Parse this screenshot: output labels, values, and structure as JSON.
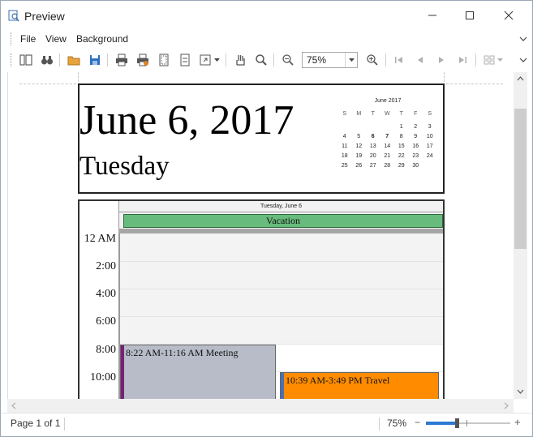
{
  "window": {
    "title": "Preview",
    "icon": "preview-app-icon"
  },
  "menu": {
    "items": [
      {
        "label": "File"
      },
      {
        "label": "View"
      },
      {
        "label": "Background"
      }
    ]
  },
  "toolbar": {
    "zoom_value": "75%",
    "icons": [
      "thumbnails-icon",
      "search-binoculars-icon",
      "open-folder-icon",
      "save-icon",
      "print-icon",
      "quick-print-icon",
      "page-setup-icon",
      "scale-icon",
      "page-margins-icon",
      "hand-tool-icon",
      "magnifier-icon",
      "zoom-out-icon",
      "zoom-in-icon",
      "first-page-icon",
      "previous-page-icon",
      "next-page-icon",
      "last-page-icon",
      "multiple-pages-icon"
    ]
  },
  "calendar_page": {
    "date_heading": "June 6, 2017",
    "weekday_heading": "Tuesday",
    "mini_calendar": {
      "title": "June 2017",
      "weekdays": [
        "S",
        "M",
        "T",
        "W",
        "T",
        "F",
        "S"
      ],
      "weeks": [
        [
          "",
          "",
          "",
          "",
          "1",
          "2",
          "3"
        ],
        [
          "4",
          "5",
          "6",
          "7",
          "8",
          "9",
          "10"
        ],
        [
          "11",
          "12",
          "13",
          "14",
          "15",
          "16",
          "17"
        ],
        [
          "18",
          "19",
          "20",
          "21",
          "22",
          "23",
          "24"
        ],
        [
          "25",
          "26",
          "27",
          "28",
          "29",
          "30",
          ""
        ]
      ],
      "bold_days": [
        "6",
        "7"
      ]
    },
    "day_view": {
      "column_header": "Tuesday, June 6",
      "all_day_event": "Vacation",
      "time_labels": [
        "12 AM",
        "2:00",
        "4:00",
        "6:00",
        "8:00",
        "10:00"
      ],
      "appointments": [
        {
          "text": "8:22 AM-11:16 AM Meeting",
          "color": "#b7bcc8",
          "bar_color": "#7a1f7a"
        },
        {
          "text": "10:39 AM-3:49 PM Travel",
          "color": "#ff8c00",
          "bar_color": "#4a6fb5"
        }
      ],
      "vacation_color": "#67bb7c"
    }
  },
  "status": {
    "page_info": "Page 1 of 1",
    "zoom_value": "75%",
    "zoom_out": "−",
    "zoom_in": "+"
  }
}
